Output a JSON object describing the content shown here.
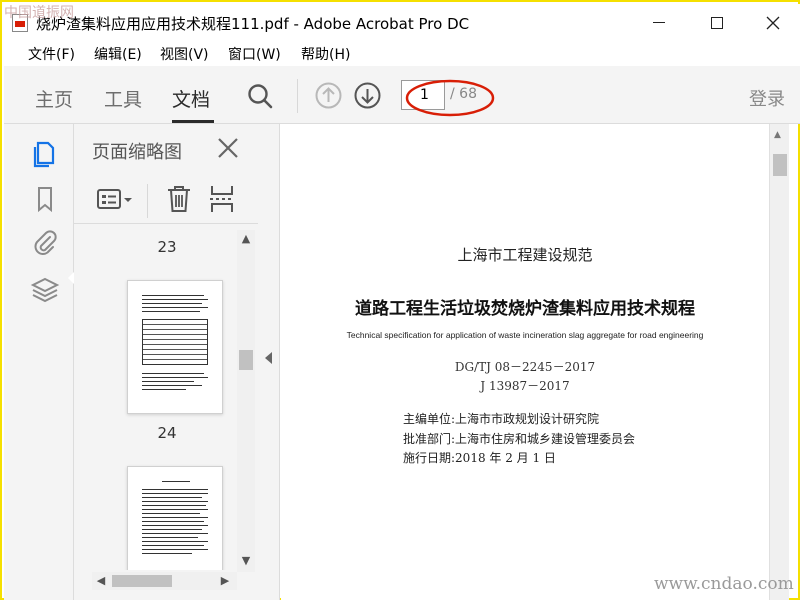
{
  "watermark": {
    "top": "中国道振网",
    "bottom": "www.cndao.com"
  },
  "window": {
    "title": "烧炉渣集料应用应用技术规程111.pdf - Adobe Acrobat Pro DC",
    "buttons": [
      "minimize-icon",
      "maximize-icon",
      "close-icon"
    ]
  },
  "menu": {
    "items": [
      "文件(F)",
      "编辑(E)",
      "视图(V)",
      "窗口(W)",
      "帮助(H)"
    ]
  },
  "toolbar": {
    "tabs": [
      "主页",
      "工具",
      "文档"
    ],
    "active_tab": "文档",
    "page_current": "1",
    "page_total": "/ 68",
    "login": "登录",
    "highlight_color": "#d81e06"
  },
  "left_rail": {
    "icons": [
      "page-thumbnails-icon",
      "bookmark-icon",
      "attachment-icon",
      "layers-icon"
    ],
    "active_color": "#1473e6"
  },
  "thumbnail_panel": {
    "title": "页面缩略图",
    "pages": [
      "23",
      "24"
    ]
  },
  "document": {
    "org": "上海市工程建设规范",
    "title": "道路工程生活垃圾焚烧炉渣集料应用技术规程",
    "en_title": "Technical specification for application of waste incineration slag aggregate for road engineering",
    "code1": "DG/TJ 08－2245－2017",
    "code2": "J 13987－2017",
    "editor": "主编单位:上海市市政规划设计研究院",
    "approver": "批准部门:上海市住房和城乡建设管理委员会",
    "date": "施行日期:2018 年 2 月 1 日"
  }
}
